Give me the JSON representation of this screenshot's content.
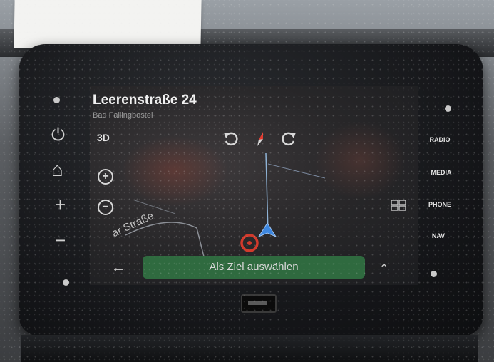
{
  "header": {
    "title": "Leerenstraße 24",
    "subtitle": "Bad Fallingbostel"
  },
  "map": {
    "mode_label": "3D",
    "street_label": "ar Straße",
    "compass_icon": "compass-icon",
    "position_marker": "location-arrow-icon"
  },
  "controls": {
    "rotate_left_icon": "rotate-left-icon",
    "rotate_right_icon": "rotate-right-icon",
    "zoom_in_icon": "zoom-in-icon",
    "zoom_out_icon": "zoom-out-icon",
    "grid_icon": "grid-icon"
  },
  "action": {
    "label": "Als Ziel auswählen",
    "back_icon": "back-arrow-icon",
    "expand_icon": "chevron-up-icon",
    "color": "#2f6a3f"
  },
  "left_buttons": [
    {
      "icon": "power-icon",
      "glyph": "⏻"
    },
    {
      "icon": "home-icon",
      "glyph": "⌂"
    },
    {
      "icon": "plus-icon",
      "glyph": "+"
    },
    {
      "icon": "minus-icon",
      "glyph": "−"
    }
  ],
  "right_buttons": [
    {
      "label": "RADIO"
    },
    {
      "label": "MEDIA"
    },
    {
      "label": "PHONE"
    },
    {
      "label": "NAV"
    }
  ]
}
